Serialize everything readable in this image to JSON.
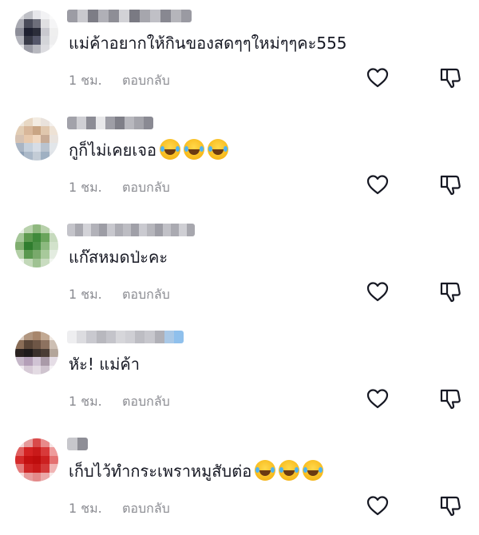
{
  "comments": [
    {
      "text": "แม่ค้าอยากให้กินของสดๆๆใหม่ๆๆคะ555",
      "emojis": [],
      "time": "1 ชม.",
      "reply_label": "ตอบกลับ",
      "avatar_colors": [
        "#d8d8dc",
        "#bfc0c6",
        "#e6e6ea",
        "#f2f2f4",
        "#fafafa",
        "#a9aab2",
        "#4a4c5a",
        "#6d6e7a",
        "#e0e0e2",
        "#f5f5f6",
        "#8c8d98",
        "#1e2030",
        "#2b2d3a",
        "#c9c9cf",
        "#efefef",
        "#b3b4bc",
        "#393b48",
        "#55576a",
        "#d4d5d9",
        "#eeeeef",
        "#e4e4e7",
        "#9a9ba5",
        "#b7b8bf",
        "#dcdce0",
        "#f4f4f5"
      ],
      "username_colors": [
        "#9c9ca4",
        "#c9c9ce",
        "#7d7d86",
        "#b0b0b7",
        "#8e8e96",
        "#d2d2d6",
        "#7a7a83",
        "#a6a6ad",
        "#c0c0c6",
        "#888891",
        "#b5b5bb",
        "#9a9aa2"
      ]
    },
    {
      "text": "กูก็ไม่เคยเจอ",
      "emojis": [
        "face-with-tears-of-joy",
        "face-with-tears-of-joy",
        "face-with-tears-of-joy"
      ],
      "time": "1 ชม.",
      "reply_label": "ตอบกลับ",
      "avatar_colors": [
        "#eee6dc",
        "#e8d8c4",
        "#f3ece2",
        "#e9e2dc",
        "#f4f1ee",
        "#e2cdb4",
        "#d8b79a",
        "#c9a584",
        "#e0c7ad",
        "#eee2d5",
        "#d6c2b2",
        "#e7c9ad",
        "#f0d7bf",
        "#c8ab95",
        "#e9e3de",
        "#a9b5c4",
        "#c5d0dc",
        "#d6dde6",
        "#b9c3cf",
        "#e2e6ea",
        "#8d9fb5",
        "#aab8c8",
        "#c3ccd6",
        "#9fb0c2",
        "#dfe3e8"
      ],
      "username_colors": [
        "#a2a2aa",
        "#cfcfd4",
        "#8c8c95",
        "#e8e8ea",
        "#9e9ea6",
        "#7f7f88",
        "#b8b8be",
        "#a4a4ab",
        "#8a8a93"
      ]
    },
    {
      "text": "แก๊สหมดป่ะคะ",
      "emojis": [],
      "time": "1 ชม.",
      "reply_label": "ตอบกลับ",
      "avatar_colors": [
        "#e9efe6",
        "#b9d2ad",
        "#8fb87f",
        "#b7d0aa",
        "#eef3ec",
        "#a5c799",
        "#5d9a4f",
        "#3f8a3a",
        "#6aa45c",
        "#c6dabd",
        "#7fae6f",
        "#2f7d2e",
        "#4c9147",
        "#8cb97f",
        "#d2e2cb",
        "#b3cfa6",
        "#5a984f",
        "#79a96b",
        "#a8c99b",
        "#e3ece0",
        "#eef3ec",
        "#c2d8b8",
        "#9fc292",
        "#c9dcc0",
        "#f2f6f0"
      ],
      "username_colors": [
        "#c4c4ca",
        "#a9a9b0",
        "#d3d3d8",
        "#b2b2b9",
        "#9d9da5",
        "#c8c8ce",
        "#adadb4",
        "#bdbdc3",
        "#a0a0a8",
        "#cacad0",
        "#b6b6bc",
        "#9e9ea6",
        "#c1c1c7",
        "#aaaab1",
        "#cfcfd4",
        "#a7a7ae"
      ]
    },
    {
      "text": "หัะ! แม่ค้า",
      "emojis": [],
      "time": "1 ชม.",
      "reply_label": "ตอบกลับ",
      "avatar_colors": [
        "#d8c9bd",
        "#b19680",
        "#a7866c",
        "#c2a993",
        "#efe7e0",
        "#8a6d57",
        "#5a4638",
        "#6e5646",
        "#8d7260",
        "#cdbfb3",
        "#2a2220",
        "#1e1a1a",
        "#3a302b",
        "#4a3d35",
        "#b3a59a",
        "#c6b8c9",
        "#b49fb8",
        "#d0c3d4",
        "#a99aa8",
        "#e5dde6",
        "#efe9ef",
        "#d7cbd7",
        "#e3dbe3",
        "#cfc4cf",
        "#f5f1f5"
      ],
      "username_colors": [
        "#eeeef0",
        "#dcdce0",
        "#c9c9cf",
        "#b8b8be",
        "#c4c4ca",
        "#d6d6da",
        "#cfcfd4",
        "#bdbdc3",
        "#c7c7cd",
        "#b0b0b7",
        "#a9c8e6",
        "#8fc0ec"
      ]
    },
    {
      "text": "เก็บไว้ทำกระเพราหมูสับต่อ",
      "emojis": [
        "face-with-tears-of-joy",
        "face-with-tears-of-joy",
        "face-with-tears-of-joy"
      ],
      "time": "1 ชม.",
      "reply_label": "ตอบกลับ",
      "avatar_colors": [
        "#f3d6d6",
        "#e59a9a",
        "#d94a4a",
        "#e88a8a",
        "#f7e3e3",
        "#e06060",
        "#d42222",
        "#c91a1a",
        "#d83a3a",
        "#ee9b9b",
        "#d52a2a",
        "#c41010",
        "#be0d0d",
        "#cc2020",
        "#e47070",
        "#e57a7a",
        "#cf2626",
        "#c81a1a",
        "#d43a3a",
        "#f0b3b3",
        "#f6dada",
        "#e79c9c",
        "#e38a8a",
        "#eba9a9",
        "#f8e8e8"
      ],
      "username_colors": [
        "#c7c7cc",
        "#8e8e96"
      ]
    }
  ],
  "icons": {
    "like": "heart-outline-icon",
    "dislike": "thumbs-down-outline-icon"
  },
  "colors": {
    "text": "#161823",
    "secondary": "#8a8b91",
    "icon": "#161823"
  }
}
